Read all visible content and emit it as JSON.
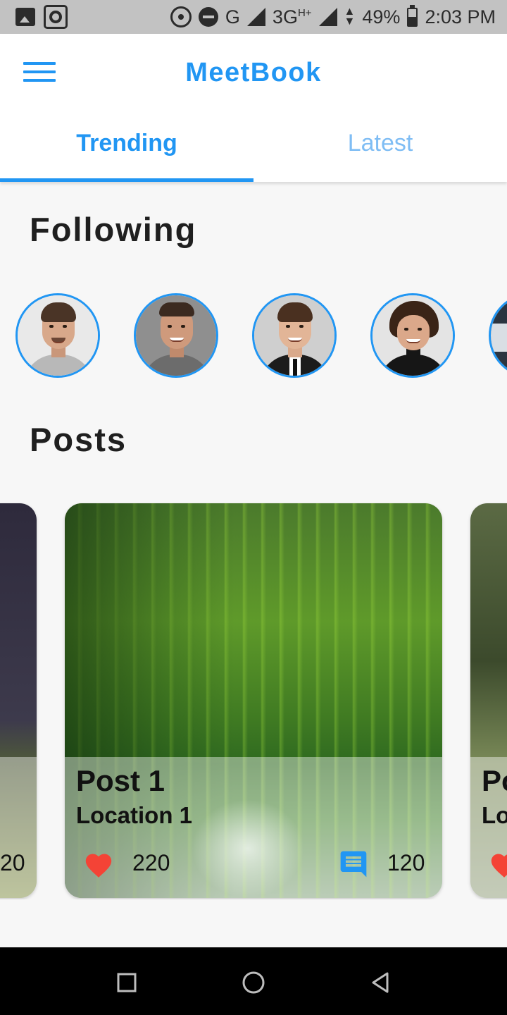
{
  "status_bar": {
    "network_g": "G",
    "network_3g": "3G",
    "network_hplus": "H+",
    "battery": "49%",
    "time": "2:03 PM"
  },
  "app_bar": {
    "menu_icon": "menu-icon",
    "title": "MeetBook",
    "brand_color": "#2196f3"
  },
  "tabs": [
    {
      "label": "Trending",
      "active": true
    },
    {
      "label": "Latest",
      "active": false
    }
  ],
  "following": {
    "title": "Following",
    "avatars": [
      {
        "name": "avatar-1"
      },
      {
        "name": "avatar-2"
      },
      {
        "name": "avatar-3"
      },
      {
        "name": "avatar-4"
      },
      {
        "name": "avatar-5"
      }
    ]
  },
  "posts": {
    "title": "Posts",
    "items": [
      {
        "title": "",
        "location": "",
        "likes": "20",
        "comments": ""
      },
      {
        "title": "Post 1",
        "location": "Location 1",
        "likes": "220",
        "comments": "120"
      },
      {
        "title": "Po",
        "location": "Lo",
        "likes": "",
        "comments": ""
      }
    ]
  },
  "icons": {
    "like": "heart-icon",
    "comment": "comment-icon",
    "like_color": "#f44336",
    "comment_color": "#2196f3"
  },
  "nav_bar": {
    "recents": "square-icon",
    "home": "circle-icon",
    "back": "triangle-back-icon"
  }
}
